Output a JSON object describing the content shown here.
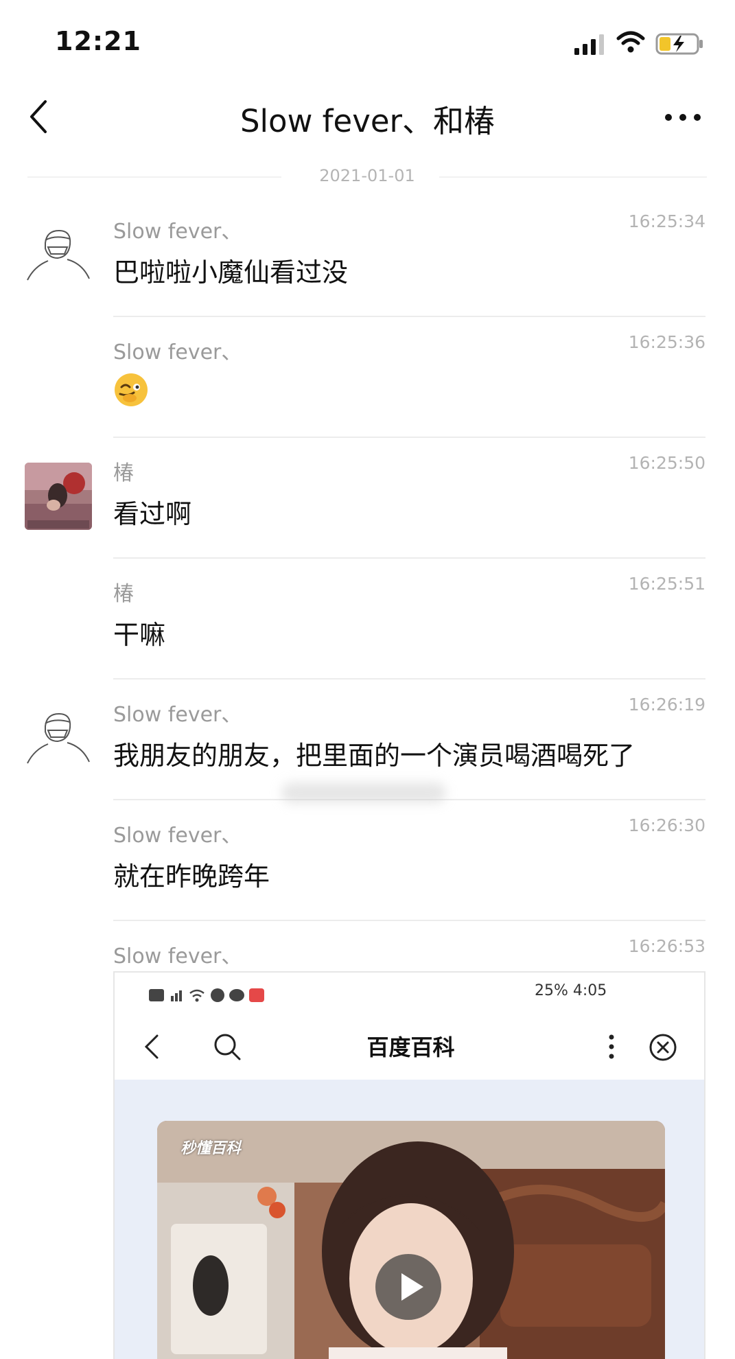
{
  "status_bar": {
    "time": "12:21"
  },
  "header": {
    "title": "Slow fever、和椿"
  },
  "date_divider": "2021-01-01",
  "messages": [
    {
      "sender": "Slow fever、",
      "time": "16:25:34",
      "text": "巴啦啦小魔仙看过没"
    },
    {
      "sender": "Slow fever、",
      "time": "16:25:36",
      "text": ""
    },
    {
      "sender": "椿",
      "time": "16:25:50",
      "text": "看过啊"
    },
    {
      "sender": "椿",
      "time": "16:25:51",
      "text": "干嘛"
    },
    {
      "sender": "Slow fever、",
      "time": "16:26:19",
      "text": "我朋友的朋友，把里面的一个演员喝酒喝死了"
    },
    {
      "sender": "Slow fever、",
      "time": "16:26:30",
      "text": "就在昨晚跨年"
    },
    {
      "sender": "Slow fever、",
      "time": "16:26:53",
      "text": ""
    }
  ],
  "embedded_screenshot": {
    "status_right": "25%  4:05",
    "nav_title": "百度百科",
    "video_watermark": "秒懂百科"
  },
  "colors": {
    "separator": "#ececec",
    "meta_text": "#9a9a9a",
    "embedded_bg": "#e9eef8"
  }
}
